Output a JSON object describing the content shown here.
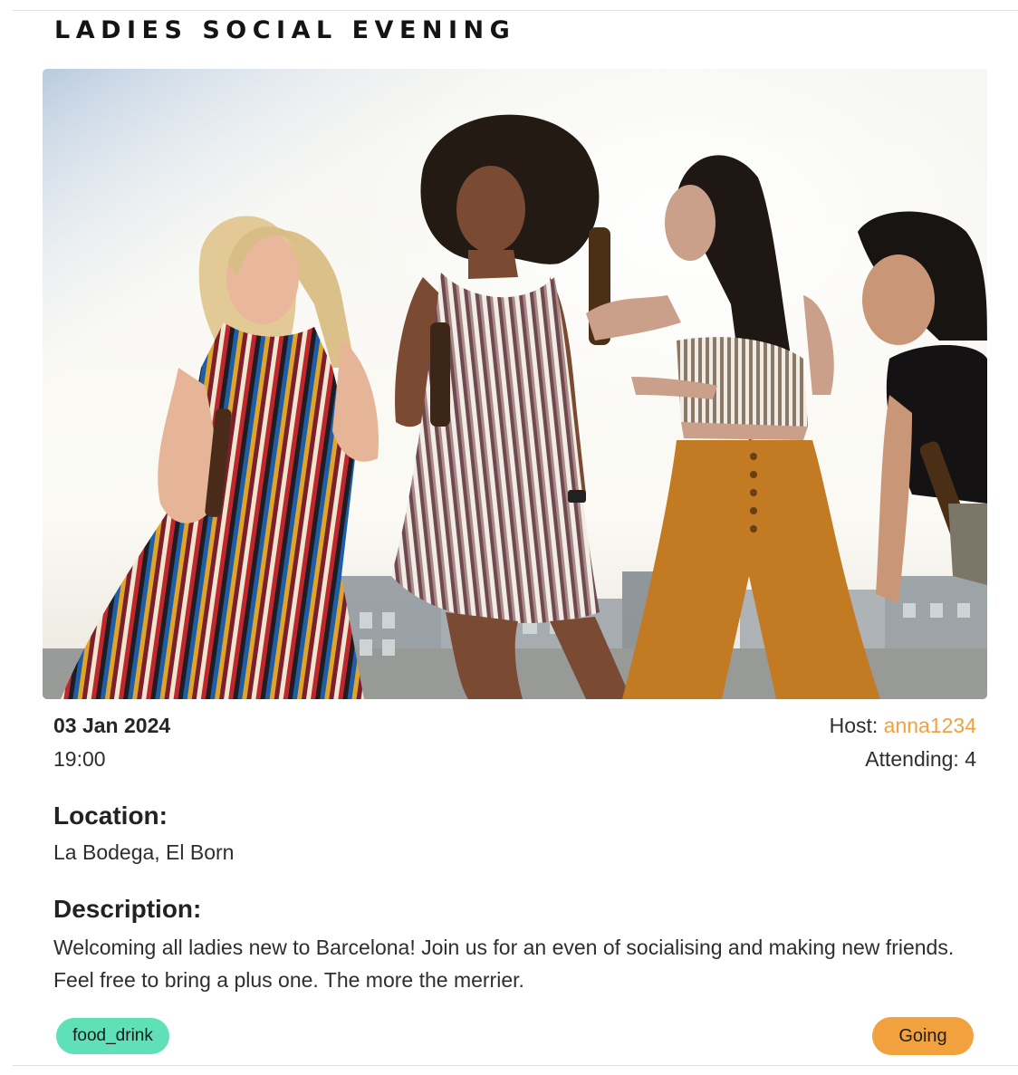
{
  "event": {
    "title": "LADIES SOCIAL EVENING",
    "image_alt": "Four women laughing and dancing on a rooftop at sunset, holding bottles",
    "date": "03 Jan 2024",
    "time": "19:00",
    "host_label": "Host: ",
    "host_name": "anna1234",
    "attending": "Attending: 4",
    "location_heading": "Location:",
    "location": "La Bodega, El Born",
    "description_heading": "Description:",
    "description": "Welcoming all ladies new to Barcelona! Join us for an even of socialising and making new friends. Feel free to bring a plus one. The more the merrier.",
    "tag": "food_drink",
    "rsvp_button": "Going"
  },
  "colors": {
    "accent": "#f2a13f",
    "tag": "#5fe0b7",
    "text": "#2e2e2e",
    "divider": "#dedede"
  }
}
